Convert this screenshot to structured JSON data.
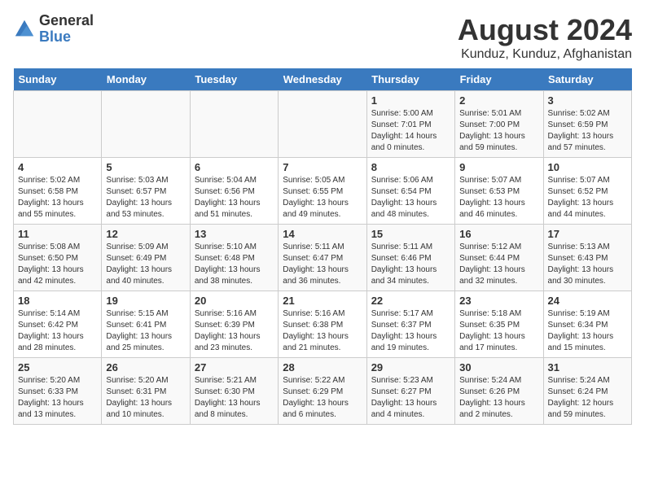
{
  "logo": {
    "text_general": "General",
    "text_blue": "Blue"
  },
  "title": "August 2024",
  "subtitle": "Kunduz, Kunduz, Afghanistan",
  "days_of_week": [
    "Sunday",
    "Monday",
    "Tuesday",
    "Wednesday",
    "Thursday",
    "Friday",
    "Saturday"
  ],
  "weeks": [
    [
      {
        "day": "",
        "detail": ""
      },
      {
        "day": "",
        "detail": ""
      },
      {
        "day": "",
        "detail": ""
      },
      {
        "day": "",
        "detail": ""
      },
      {
        "day": "1",
        "detail": "Sunrise: 5:00 AM\nSunset: 7:01 PM\nDaylight: 14 hours\nand 0 minutes."
      },
      {
        "day": "2",
        "detail": "Sunrise: 5:01 AM\nSunset: 7:00 PM\nDaylight: 13 hours\nand 59 minutes."
      },
      {
        "day": "3",
        "detail": "Sunrise: 5:02 AM\nSunset: 6:59 PM\nDaylight: 13 hours\nand 57 minutes."
      }
    ],
    [
      {
        "day": "4",
        "detail": "Sunrise: 5:02 AM\nSunset: 6:58 PM\nDaylight: 13 hours\nand 55 minutes."
      },
      {
        "day": "5",
        "detail": "Sunrise: 5:03 AM\nSunset: 6:57 PM\nDaylight: 13 hours\nand 53 minutes."
      },
      {
        "day": "6",
        "detail": "Sunrise: 5:04 AM\nSunset: 6:56 PM\nDaylight: 13 hours\nand 51 minutes."
      },
      {
        "day": "7",
        "detail": "Sunrise: 5:05 AM\nSunset: 6:55 PM\nDaylight: 13 hours\nand 49 minutes."
      },
      {
        "day": "8",
        "detail": "Sunrise: 5:06 AM\nSunset: 6:54 PM\nDaylight: 13 hours\nand 48 minutes."
      },
      {
        "day": "9",
        "detail": "Sunrise: 5:07 AM\nSunset: 6:53 PM\nDaylight: 13 hours\nand 46 minutes."
      },
      {
        "day": "10",
        "detail": "Sunrise: 5:07 AM\nSunset: 6:52 PM\nDaylight: 13 hours\nand 44 minutes."
      }
    ],
    [
      {
        "day": "11",
        "detail": "Sunrise: 5:08 AM\nSunset: 6:50 PM\nDaylight: 13 hours\nand 42 minutes."
      },
      {
        "day": "12",
        "detail": "Sunrise: 5:09 AM\nSunset: 6:49 PM\nDaylight: 13 hours\nand 40 minutes."
      },
      {
        "day": "13",
        "detail": "Sunrise: 5:10 AM\nSunset: 6:48 PM\nDaylight: 13 hours\nand 38 minutes."
      },
      {
        "day": "14",
        "detail": "Sunrise: 5:11 AM\nSunset: 6:47 PM\nDaylight: 13 hours\nand 36 minutes."
      },
      {
        "day": "15",
        "detail": "Sunrise: 5:11 AM\nSunset: 6:46 PM\nDaylight: 13 hours\nand 34 minutes."
      },
      {
        "day": "16",
        "detail": "Sunrise: 5:12 AM\nSunset: 6:44 PM\nDaylight: 13 hours\nand 32 minutes."
      },
      {
        "day": "17",
        "detail": "Sunrise: 5:13 AM\nSunset: 6:43 PM\nDaylight: 13 hours\nand 30 minutes."
      }
    ],
    [
      {
        "day": "18",
        "detail": "Sunrise: 5:14 AM\nSunset: 6:42 PM\nDaylight: 13 hours\nand 28 minutes."
      },
      {
        "day": "19",
        "detail": "Sunrise: 5:15 AM\nSunset: 6:41 PM\nDaylight: 13 hours\nand 25 minutes."
      },
      {
        "day": "20",
        "detail": "Sunrise: 5:16 AM\nSunset: 6:39 PM\nDaylight: 13 hours\nand 23 minutes."
      },
      {
        "day": "21",
        "detail": "Sunrise: 5:16 AM\nSunset: 6:38 PM\nDaylight: 13 hours\nand 21 minutes."
      },
      {
        "day": "22",
        "detail": "Sunrise: 5:17 AM\nSunset: 6:37 PM\nDaylight: 13 hours\nand 19 minutes."
      },
      {
        "day": "23",
        "detail": "Sunrise: 5:18 AM\nSunset: 6:35 PM\nDaylight: 13 hours\nand 17 minutes."
      },
      {
        "day": "24",
        "detail": "Sunrise: 5:19 AM\nSunset: 6:34 PM\nDaylight: 13 hours\nand 15 minutes."
      }
    ],
    [
      {
        "day": "25",
        "detail": "Sunrise: 5:20 AM\nSunset: 6:33 PM\nDaylight: 13 hours\nand 13 minutes."
      },
      {
        "day": "26",
        "detail": "Sunrise: 5:20 AM\nSunset: 6:31 PM\nDaylight: 13 hours\nand 10 minutes."
      },
      {
        "day": "27",
        "detail": "Sunrise: 5:21 AM\nSunset: 6:30 PM\nDaylight: 13 hours\nand 8 minutes."
      },
      {
        "day": "28",
        "detail": "Sunrise: 5:22 AM\nSunset: 6:29 PM\nDaylight: 13 hours\nand 6 minutes."
      },
      {
        "day": "29",
        "detail": "Sunrise: 5:23 AM\nSunset: 6:27 PM\nDaylight: 13 hours\nand 4 minutes."
      },
      {
        "day": "30",
        "detail": "Sunrise: 5:24 AM\nSunset: 6:26 PM\nDaylight: 13 hours\nand 2 minutes."
      },
      {
        "day": "31",
        "detail": "Sunrise: 5:24 AM\nSunset: 6:24 PM\nDaylight: 12 hours\nand 59 minutes."
      }
    ]
  ]
}
